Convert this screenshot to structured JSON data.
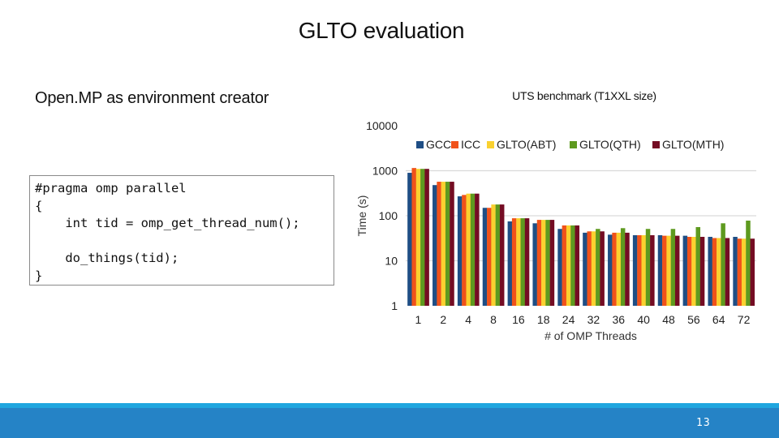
{
  "slide": {
    "title": "GLTO evaluation",
    "subtitle": "Open.MP as environment creator",
    "page_number": "13",
    "footer_colors": {
      "stripe": "#1fa6df",
      "bar": "#2583c6"
    }
  },
  "code": {
    "lines": [
      "#pragma omp parallel",
      "{",
      "    int tid = omp_get_thread_num();",
      "",
      "    do_things(tid);",
      "}"
    ]
  },
  "chart_data": {
    "type": "bar",
    "title": "UTS benchmark (T1XXL size)",
    "xlabel": "# of OMP Threads",
    "ylabel": "Time (s)",
    "yscale": "log",
    "ylim": [
      1,
      10000
    ],
    "yticks": [
      "1",
      "10",
      "100",
      "1000",
      "10000"
    ],
    "grid": true,
    "legend_position": "top",
    "categories": [
      "1",
      "2",
      "4",
      "8",
      "16",
      "18",
      "24",
      "32",
      "36",
      "40",
      "48",
      "56",
      "64",
      "72"
    ],
    "series": [
      {
        "name": "GCC",
        "color": "#1f4e85",
        "values": [
          900,
          480,
          270,
          150,
          75,
          68,
          51,
          42,
          38,
          37,
          37,
          36,
          34,
          34
        ]
      },
      {
        "name": "ICC",
        "color": "#f0521a",
        "values": [
          1150,
          570,
          290,
          150,
          88,
          81,
          61,
          45,
          42,
          37,
          36,
          34,
          32,
          31
        ]
      },
      {
        "name": "GLTO(ABT)",
        "color": "#fad130",
        "values": [
          1100,
          570,
          310,
          178,
          88,
          81,
          61,
          45,
          42,
          37,
          36,
          34,
          32,
          31
        ]
      },
      {
        "name": "GLTO(QTH)",
        "color": "#5e9a1f",
        "values": [
          1100,
          570,
          310,
          178,
          88,
          81,
          61,
          51,
          53,
          51,
          51,
          56,
          68,
          78
        ]
      },
      {
        "name": "GLTO(MTH)",
        "color": "#740c23",
        "values": [
          1100,
          570,
          310,
          178,
          88,
          81,
          61,
          45,
          42,
          37,
          36,
          34,
          32,
          31
        ]
      }
    ]
  }
}
